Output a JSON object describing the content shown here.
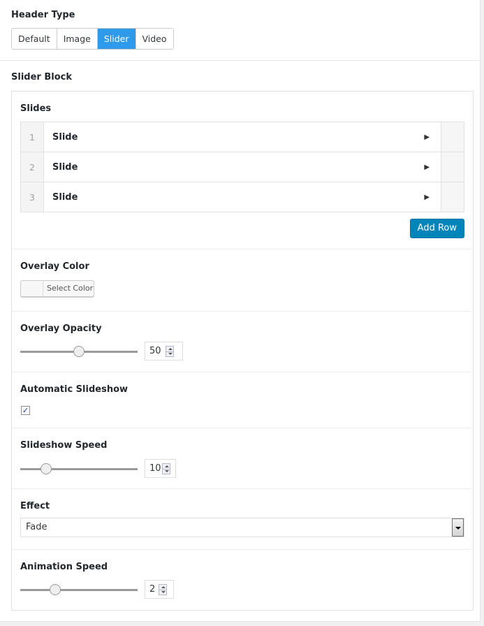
{
  "header_type": {
    "label": "Header Type",
    "options": [
      "Default",
      "Image",
      "Slider",
      "Video"
    ],
    "selected": "Slider"
  },
  "slider_block": {
    "label": "Slider Block",
    "slides": {
      "label": "Slides",
      "rows": [
        {
          "index": "1",
          "title": "Slide",
          "expand_icon": "triangle-right-icon"
        },
        {
          "index": "2",
          "title": "Slide",
          "expand_icon": "triangle-right-icon"
        },
        {
          "index": "3",
          "title": "Slide",
          "expand_icon": "triangle-right-icon"
        }
      ],
      "add_row_label": "Add Row"
    },
    "overlay_color": {
      "label": "Overlay Color",
      "button_label": "Select Color"
    },
    "overlay_opacity": {
      "label": "Overlay Opacity",
      "value": "50",
      "fraction": 0.5
    },
    "automatic_slideshow": {
      "label": "Automatic Slideshow",
      "checked": true,
      "check_glyph": "✓"
    },
    "slideshow_speed": {
      "label": "Slideshow Speed",
      "value": "10",
      "fraction": 0.22
    },
    "effect": {
      "label": "Effect",
      "selected": "Fade"
    },
    "animation_speed": {
      "label": "Animation Speed",
      "value": "2",
      "fraction": 0.3
    }
  },
  "colors": {
    "active_segment": "#2e9ae9",
    "primary_button": "#0085ba"
  }
}
